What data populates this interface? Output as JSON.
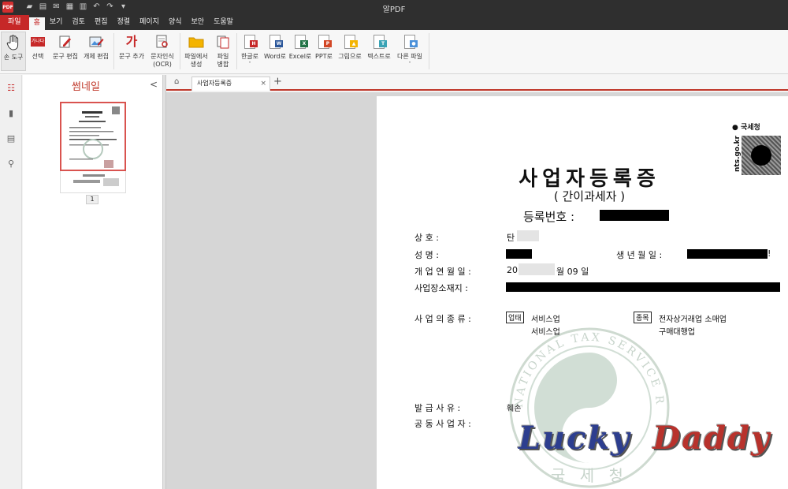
{
  "app": {
    "title": "알PDF",
    "logo": "PDF"
  },
  "quick_access": [
    "folder-icon",
    "save-icon",
    "mail-icon",
    "print-icon",
    "preview-icon",
    "undo-icon",
    "redo-icon",
    "customize-icon"
  ],
  "menu": {
    "file": "파일",
    "tabs": [
      "홈",
      "보기",
      "검토",
      "편집",
      "정렬",
      "페이지",
      "양식",
      "보안",
      "도움말"
    ],
    "active": "홈"
  },
  "ribbon": {
    "hand_tool": "손 도구",
    "select": "선택",
    "select_icon_text": "가나다",
    "text_edit": "문구 편집",
    "object_edit": "개체 편집",
    "add_text": "문구 추가",
    "add_text_icon": "가",
    "ocr_line1": "문자인식",
    "ocr_line2": "(OCR)",
    "create_line1": "파일에서",
    "create_line2": "생성",
    "merge_line1": "파일",
    "merge_line2": "병합",
    "to_hangul": "한글로",
    "to_word": "Word로",
    "to_excel": "Excel로",
    "to_ppt": "PPT로",
    "to_image": "그림으로",
    "to_text": "텍스트로",
    "to_other": "다른 파일",
    "dropdown_arrow": "˅"
  },
  "thumbnails": {
    "title": "썸네일",
    "collapse": "<",
    "page_number": "1"
  },
  "document_tab": {
    "name": "사업자등록증",
    "close": "×",
    "new_tab": "+"
  },
  "document": {
    "title": "사업자등록증",
    "subtitle": "( 간이과세자 )",
    "reg_label": "등록번호 :",
    "nts_logo": "국세청",
    "nts_url": "nts.go.kr",
    "fields": {
      "name_label": "상            호 :",
      "name_value": "탄",
      "rep_label": "성            명 :",
      "birth_label": "생 년 월 일 :",
      "birth_suffix": "!",
      "start_label": "개 업 연 월 일 :",
      "start_prefix": "20",
      "start_suffix": "월 09 일",
      "address_label": "사업장소재지 :",
      "business_label": "사 업 의 종 류 :",
      "category_tag": "업태",
      "category_1": "서비스업",
      "category_2": "서비스업",
      "item_tag": "종목",
      "item_1": "전자상거래업 소매업",
      "item_2": "구매대행업",
      "issue_label": "발  급  사  유 :",
      "issue_value": "훼손",
      "co_owner_label": "공 동 사 업 자 :"
    },
    "seal_top_text": "NATIONAL TAX SERVICE REPUBLIC OF KOREA",
    "seal_bottom_text": "국 세 청",
    "watermark_1": "Lucky",
    "watermark_2": "Daddy"
  },
  "colors": {
    "accent": "#c62828",
    "titlebar": "#2f2f2f",
    "ribbon": "#f7f7f7"
  }
}
